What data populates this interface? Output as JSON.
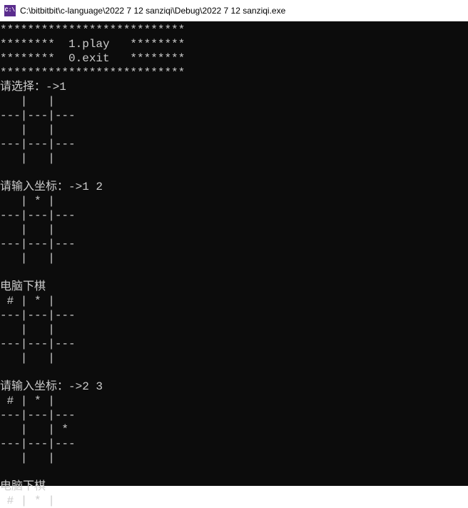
{
  "title_bar": {
    "icon_text": "C:\\",
    "path": "C:\\bitbitbit\\c-language\\2022 7 12 sanziqi\\Debug\\2022 7 12 sanziqi.exe"
  },
  "console": {
    "lines": [
      "***************************",
      "********  1.play   ********",
      "********  0.exit   ********",
      "***************************",
      "请选择：->1",
      "   |   |   ",
      "---|---|---",
      "   |   |   ",
      "---|---|---",
      "   |   |   ",
      "",
      "请输入坐标：->1 2",
      "   | * |   ",
      "---|---|---",
      "   |   |   ",
      "---|---|---",
      "   |   |   ",
      "",
      "电脑下棋",
      " # | * |   ",
      "---|---|---",
      "   |   |   ",
      "---|---|---",
      "   |   |   ",
      "",
      "请输入坐标：->2 3",
      " # | * |   ",
      "---|---|---",
      "   |   | * ",
      "---|---|---",
      "   |   |   ",
      "",
      "电脑下棋",
      " # | * |   "
    ]
  }
}
